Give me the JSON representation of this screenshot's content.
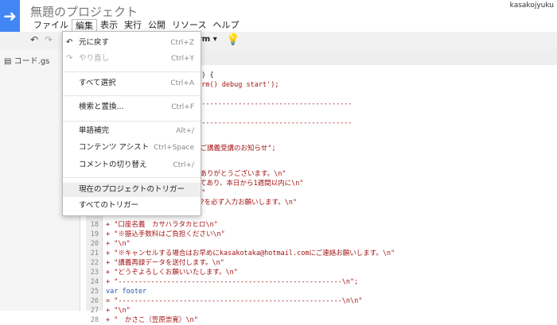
{
  "app": {
    "title": "無題のプロジェクト",
    "user": "kasakojyuku"
  },
  "menubar": [
    "ファイル",
    "編集",
    "表示",
    "実行",
    "公開",
    "リソース",
    "ヘルプ"
  ],
  "toolbar": {
    "dropdown_label": "orm ▾"
  },
  "sidebar": {
    "file_name": "コード.gs"
  },
  "edit_menu": {
    "items": [
      {
        "icon": "undo-icon",
        "label": "元に戻す",
        "shortcut": "Ctrl+Z"
      },
      {
        "icon": "redo-icon",
        "label": "やり直し",
        "shortcut": "Ctrl+Y",
        "disabled": true
      },
      {
        "label": "すべて選択",
        "shortcut": "Ctrl+A"
      },
      {
        "label": "検索と置換...",
        "shortcut": "Ctrl+F"
      },
      {
        "label": "単語補完",
        "shortcut": "Alt+/"
      },
      {
        "label": "コンテンツ アシスト",
        "shortcut": "Ctrl+Space"
      },
      {
        "label": "コメントの切り替え",
        "shortcut": "Ctrl+/"
      },
      {
        "label": "現在のプロジェクトのトリガー",
        "highlighted": true
      },
      {
        "label": "すべてのトリガー"
      }
    ]
  },
  "code_lines": [
    {
      "n": "",
      "text": "m() {"
    },
    {
      "n": "",
      "text": "Form() debug start');"
    },
    {
      "n": "",
      "text": "---------------------------------------"
    },
    {
      "n": "",
      "text": "---------------------------------------"
    },
    {
      "n": "",
      "text": "きご講義受講のお知らせ\";"
    },
    {
      "n": "",
      "text": "きありがとうございます。\\n\""
    },
    {
      "n": "",
      "text": "ってあり、本日から1週間以内に\\n\""
    },
    {
      "n": "",
      "text": " \\n\""
    },
    {
      "n": "",
      "text": "か?を必ず入力お願いします。\\n\""
    },
    {
      "n": "18",
      "text": "+ \"口座名義　カサハラタカヒロ\\n\""
    },
    {
      "n": "19",
      "text": "+ \"※振込手数料はご負担ください\\n\""
    },
    {
      "n": "20",
      "text": "+ \"\\n\""
    },
    {
      "n": "21",
      "text": "+ \"※キャンセルする場合はお早めにkasakotaka@hotmail.comにご連絡お願いします。\\n\""
    },
    {
      "n": "22",
      "text": "+ \"講義再録データを送付します。\\n\""
    },
    {
      "n": "23",
      "text": "+ \"どうぞよろしくお願いいたします。\\n\""
    },
    {
      "n": "24",
      "text": "+ \"-------------------------------------------------------\\n\";"
    },
    {
      "n": "25",
      "text": "var footer"
    },
    {
      "n": "26",
      "text": "= \"-------------------------------------------------------\\n\\n\""
    },
    {
      "n": "27",
      "text": "+ \"\\n\""
    },
    {
      "n": "28",
      "text": "+ \"　かさこ（笠原崇寛）\\n\""
    }
  ]
}
